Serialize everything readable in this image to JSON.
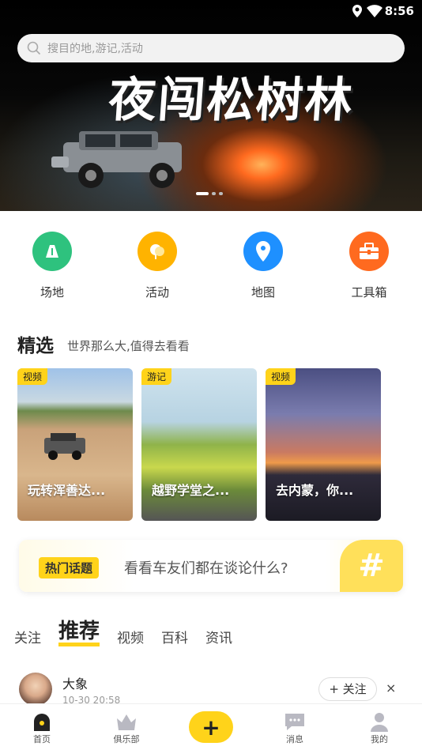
{
  "status_bar": {
    "time": "8:56"
  },
  "search": {
    "placeholder": "搜目的地,游记,活动"
  },
  "banner": {
    "title": "夜闯松树林"
  },
  "categories": [
    {
      "label": "场地",
      "color": "#2ec27e",
      "icon": "road-icon"
    },
    {
      "label": "活动",
      "color": "#ffb300",
      "icon": "balloon-icon"
    },
    {
      "label": "地图",
      "color": "#1e90ff",
      "icon": "map-pin-icon"
    },
    {
      "label": "工具箱",
      "color": "#ff6a1f",
      "icon": "toolbox-icon"
    }
  ],
  "featured": {
    "title": "精选",
    "subtitle": "世界那么大,值得去看看",
    "cards": [
      {
        "tag": "视频",
        "title": "玩转浑善达..."
      },
      {
        "tag": "游记",
        "title": "越野学堂之..."
      },
      {
        "tag": "视频",
        "title": "去内蒙，你..."
      }
    ]
  },
  "topic": {
    "pill": "热门话题",
    "text": "看看车友们都在谈论什么?"
  },
  "feed_tabs": [
    "关注",
    "推荐",
    "视频",
    "百科",
    "资讯"
  ],
  "post": {
    "user": "大象",
    "time": "10-30 20:58",
    "follow": "+ 关注",
    "close": "×"
  },
  "nav": {
    "home": "首页",
    "club": "俱乐部",
    "add": "+",
    "messages": "消息",
    "mine": "我的"
  }
}
